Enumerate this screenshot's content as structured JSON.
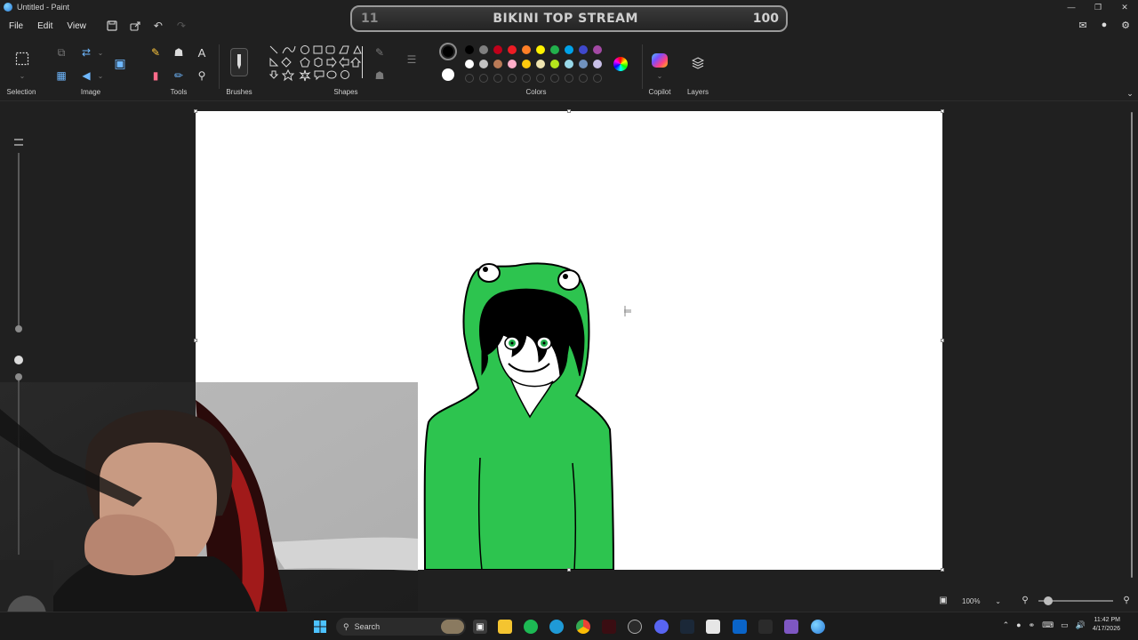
{
  "window": {
    "title": "Untitled - Paint"
  },
  "overlay": {
    "left_number": "11",
    "title": "BIKINI TOP STREAM",
    "right_number": "100"
  },
  "menu": {
    "items": [
      "File",
      "Edit",
      "View"
    ]
  },
  "ribbon": {
    "groups": {
      "selection": "Selection",
      "image": "Image",
      "tools": "Tools",
      "brushes": "Brushes",
      "shapes": "Shapes",
      "colors": "Colors",
      "copilot": "Copilot",
      "layers": "Layers"
    },
    "palette_row1": [
      "#000000",
      "#7f7f7f",
      "#c0001a",
      "#ed1c24",
      "#ff7f27",
      "#fff200",
      "#22b14c",
      "#00a2e8",
      "#3f48cc",
      "#a349a4"
    ],
    "palette_row2": [
      "#ffffff",
      "#c3c3c3",
      "#b97a57",
      "#ffaec9",
      "#ffc90e",
      "#efe4b0",
      "#b5e61d",
      "#99d9ea",
      "#7092be",
      "#c8bfe7"
    ],
    "primary_color": "#000000",
    "secondary_color": "#ffffff"
  },
  "status": {
    "zoom": "100%"
  },
  "taskbar": {
    "search_placeholder": "Search",
    "time": "11:42 PM",
    "date": "4/17/2026"
  },
  "drawing": {
    "hoodie_color": "#2dc44f",
    "eye_color": "#22b14c"
  }
}
